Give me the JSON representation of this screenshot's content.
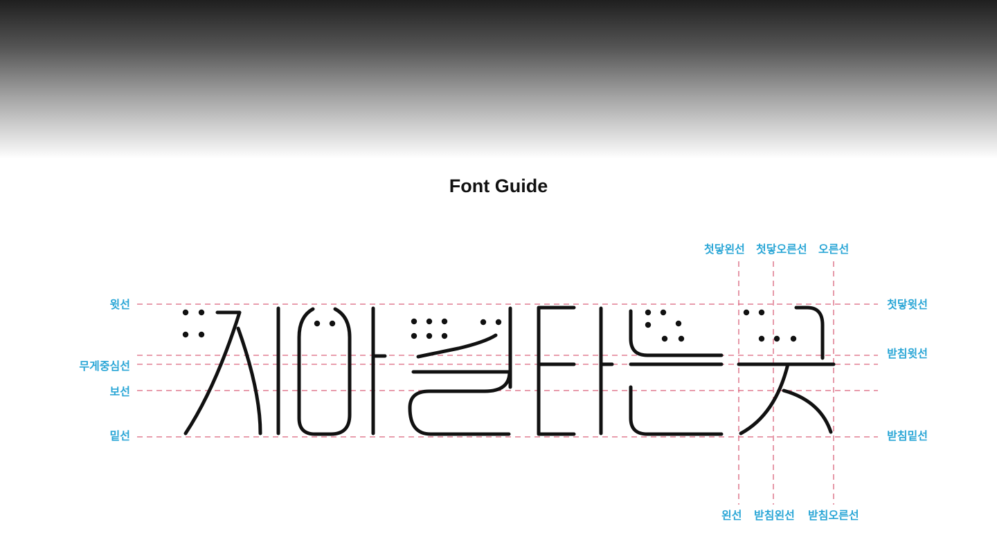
{
  "title": "Font Guide",
  "colors": {
    "label": "#2aa6d6",
    "guide_line": "#d9607a",
    "glyph": "#111111"
  },
  "guides_left": {
    "top_line": "윗선",
    "weight_center": "무게중심선",
    "reference": "보선",
    "baseline": "밑선"
  },
  "guides_right": {
    "initial_top": "첫닿윗선",
    "final_top": "받침윗선",
    "final_bottom": "받침밑선"
  },
  "guides_top": {
    "initial_left": "첫닿왼선",
    "initial_right": "첫닿오른선",
    "right": "오른선"
  },
  "guides_bottom": {
    "left": "왼선",
    "final_left": "받침왼선",
    "final_right": "받침오른선"
  }
}
